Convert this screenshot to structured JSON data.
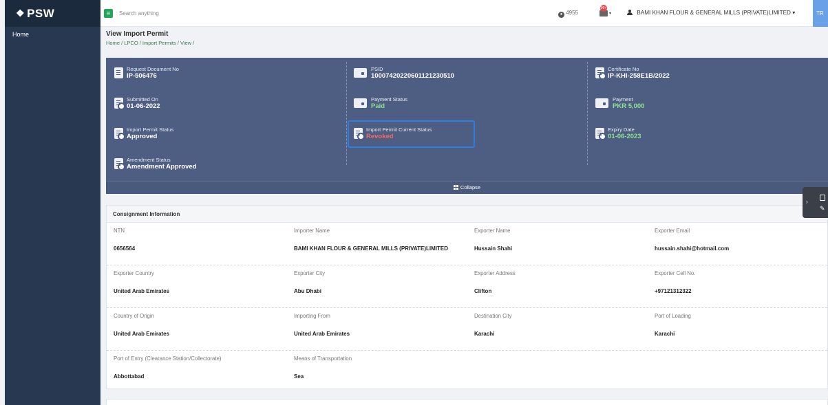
{
  "sidebar": {
    "logo": "PSW",
    "logo_glyph": "❖",
    "items": [
      {
        "label": "Home"
      }
    ]
  },
  "topbar": {
    "search_placeholder": "Search anything",
    "notification_count": "4955",
    "msg_badge": "99+",
    "user_name": "BAMI KHAN FLOUR & GENERAL MILLS (PRIVATE)LIMITED",
    "user_caret": "▾",
    "tr_label": "TR"
  },
  "page": {
    "title": "View Import Permit",
    "breadcrumb": "Home / LPCO / Import Permits / View /"
  },
  "summary": {
    "request_doc": {
      "label": "Request Document No",
      "value": "IP-506476"
    },
    "psid": {
      "label": "PSID",
      "value": "10007420220601121230510"
    },
    "certificate": {
      "label": "Certificate No",
      "value": "IP-KHI-258E1B/2022"
    },
    "submitted": {
      "label": "Submitted On",
      "value": "01-06-2022"
    },
    "payment_status": {
      "label": "Payment Status",
      "value": "Paid"
    },
    "payment": {
      "label": "Payment",
      "value": "PKR 5,000"
    },
    "permit_status": {
      "label": "Import Permit Status",
      "value": "Approved"
    },
    "current_status": {
      "label": "Import Permit Current Status",
      "value": "Revoked"
    },
    "expiry": {
      "label": "Expiry Date",
      "value": "01-06-2023"
    },
    "amendment": {
      "label": "Amendment Status",
      "value": "Amendment Approved"
    },
    "collapse_label": "Collapse",
    "colors": {
      "green": "#8fe28f",
      "red": "#f06a6a",
      "highlight": "#2f7de1"
    }
  },
  "consignment": {
    "title": "Consignment Information",
    "rows": [
      [
        {
          "k": "NTN",
          "v": "0656564"
        },
        {
          "k": "Importer Name",
          "v": "BAMI KHAN FLOUR & GENERAL MILLS (PRIVATE)LIMITED"
        },
        {
          "k": "Exporter Name",
          "v": "Hussain Shahi"
        },
        {
          "k": "Exporter Email",
          "v": "hussain.shahi@hotmail.com"
        }
      ],
      [
        {
          "k": "Exporter Country",
          "v": "United Arab Emirates"
        },
        {
          "k": "Exporter City",
          "v": "Abu Dhabi"
        },
        {
          "k": "Exporter Address",
          "v": "Clifton"
        },
        {
          "k": "Exporter Cell No.",
          "v": "+97121312322"
        }
      ],
      [
        {
          "k": "Country of Origin",
          "v": "United Arab Emirates"
        },
        {
          "k": "Importing From",
          "v": "United Arab Emirates"
        },
        {
          "k": "Destination City",
          "v": "Karachi"
        },
        {
          "k": "Port of Loading",
          "v": "Karachi"
        }
      ],
      [
        {
          "k": "Port of Entry (Clearance Station/Collectorate)",
          "v": "Abbottabad"
        },
        {
          "k": "Means of Transportation",
          "v": "Sea"
        }
      ]
    ]
  }
}
